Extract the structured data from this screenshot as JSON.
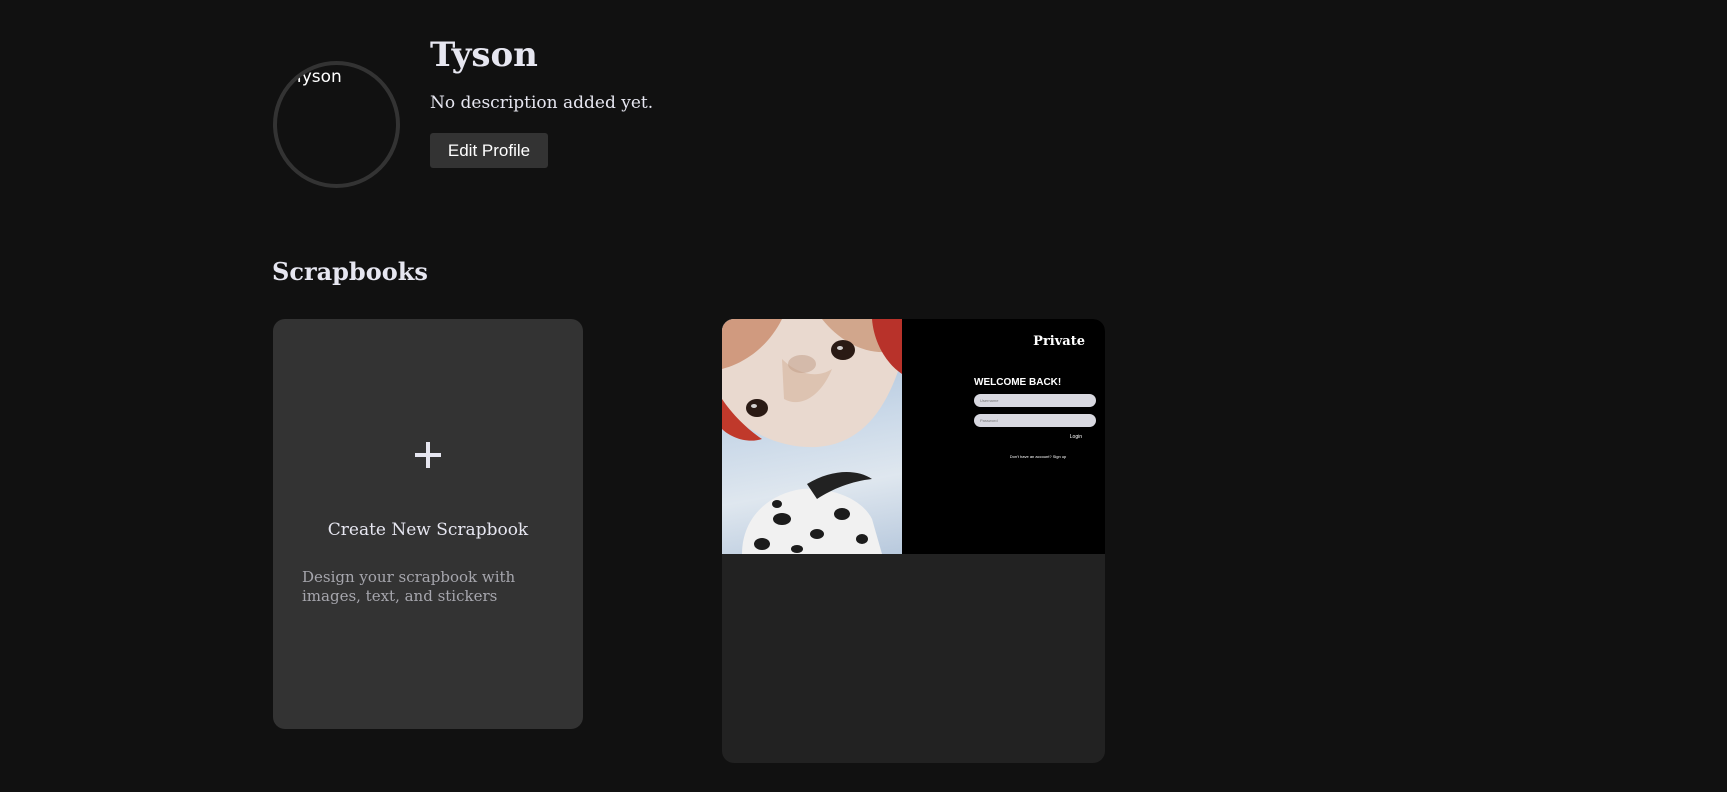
{
  "profile": {
    "avatar_alt": "Tyson",
    "name": "Tyson",
    "description": "No description added yet.",
    "edit_label": "Edit Profile"
  },
  "section": {
    "title": "Scrapbooks"
  },
  "create_card": {
    "icon": "plus-icon",
    "title": "Create New Scrapbook",
    "subtitle": "Design your scrapbook with images, text, and stickers"
  },
  "scrapbooks": [
    {
      "visibility": "Private",
      "thumbnail": {
        "heading": "WELCOME BACK!",
        "username_placeholder": "Username",
        "password_placeholder": "Password",
        "login_label": "Login",
        "signup_text": "Don't have an account? Sign up"
      }
    }
  ],
  "colors": {
    "background": "#111111",
    "card": "#333333",
    "card_dark": "#222222",
    "text": "#e6e6f0",
    "muted": "#a6a6ad"
  }
}
